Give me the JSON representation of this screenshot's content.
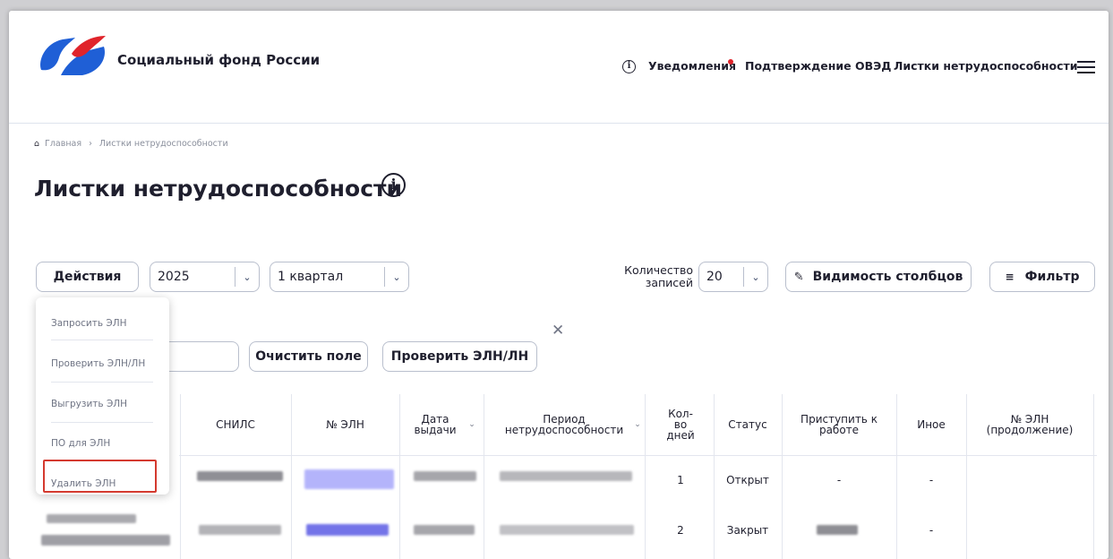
{
  "header": {
    "brand": "Социальный фонд России",
    "info_icon": "i",
    "nav": [
      "Уведомления",
      "Подтверждение ОВЭД",
      "Листки нетрудоспособности"
    ]
  },
  "breadcrumb": {
    "home": "Главная",
    "current": "Листки нетрудоспособности"
  },
  "page": {
    "title": "Листки нетрудоспособности",
    "title_info_icon": "i"
  },
  "toolbar": {
    "actions_label": "Действия",
    "year": "2025",
    "quarter": "1 квартал",
    "records_label": "Количество записей",
    "records_value": "20",
    "columns_label": "Видимость столбцов",
    "filter_label": "Фильтр",
    "clear_label": "Очистить поле",
    "check_label": "Проверить ЭЛН/ЛН",
    "close_icon": "✕"
  },
  "actions_menu": [
    "Запросить ЭЛН",
    "Проверить ЭЛН/ЛН",
    "Выгрузить ЭЛН",
    "ПО для ЭЛН",
    "Удалить ЭЛН"
  ],
  "table": {
    "headers": [
      "СНИЛС",
      "№ ЭЛН",
      "Дата выдачи",
      "Период нетрудоспособности",
      "Кол-во дней",
      "Статус",
      "Приступить к работе",
      "Иное",
      "№ ЭЛН (продолжение)"
    ],
    "rows": [
      {
        "days": "1",
        "status": "Открыт",
        "work": "-",
        "other": "-"
      },
      {
        "days": "2",
        "status": "Закрыт",
        "work": "",
        "other": "-"
      }
    ]
  },
  "colors": {
    "brand_blue": "#1f5fd6",
    "brand_red": "#e0242b",
    "highlight": "#d43a2f"
  }
}
